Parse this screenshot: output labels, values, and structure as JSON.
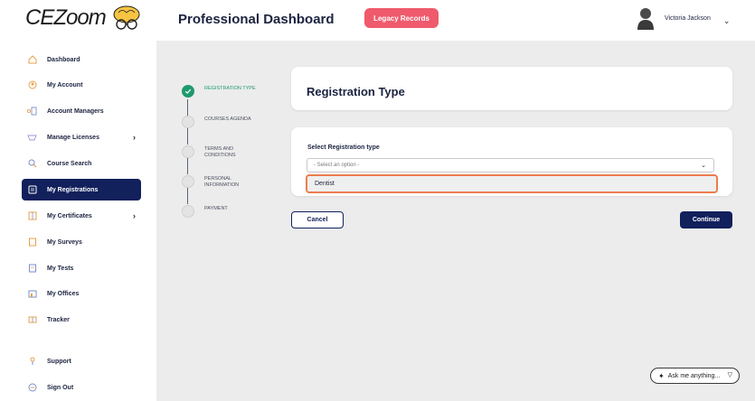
{
  "header": {
    "logo_text": "CEZoom",
    "title": "Professional Dashboard",
    "legacy_button": "Legacy Records",
    "user_name": "Victoria Jackson",
    "accent": "#ef5a6c"
  },
  "sidebar": {
    "items": [
      {
        "label": "Dashboard",
        "icon": "home-icon"
      },
      {
        "label": "My Account",
        "icon": "account-icon"
      },
      {
        "label": "Account Managers",
        "icon": "managers-icon"
      },
      {
        "label": "Manage Licenses",
        "icon": "license-icon"
      },
      {
        "label": "Course Search",
        "icon": "search-icon"
      },
      {
        "label": "My Registrations",
        "icon": "registrations-icon"
      },
      {
        "label": "My Certificates",
        "icon": "certificate-icon"
      },
      {
        "label": "My Surveys",
        "icon": "survey-icon"
      },
      {
        "label": "My Tests",
        "icon": "test-icon"
      },
      {
        "label": "My Offices",
        "icon": "office-icon"
      },
      {
        "label": "Tracker",
        "icon": "tracker-icon"
      },
      {
        "label": "Support",
        "icon": "support-icon"
      },
      {
        "label": "Sign Out",
        "icon": "signout-icon"
      }
    ],
    "active_color": "#12205c"
  },
  "stepper": {
    "steps": [
      {
        "label": "REGISTRATION TYPE"
      },
      {
        "label": "COURSES AGENDA"
      },
      {
        "label": "TERMS AND CONDITIONS"
      },
      {
        "label": "PERSONAL INFORMATION"
      },
      {
        "label": "PAYMENT"
      }
    ],
    "done_color": "#1e9a6e"
  },
  "main": {
    "card_title": "Registration Type",
    "field_label": "Select Registration type",
    "select_placeholder": "- Select an option -",
    "dropdown_option": "Dentist",
    "cancel_label": "Cancel",
    "continue_label": "Continue",
    "highlight_color": "#ec7d4f"
  },
  "assistant": {
    "placeholder": "Ask me anything..."
  }
}
